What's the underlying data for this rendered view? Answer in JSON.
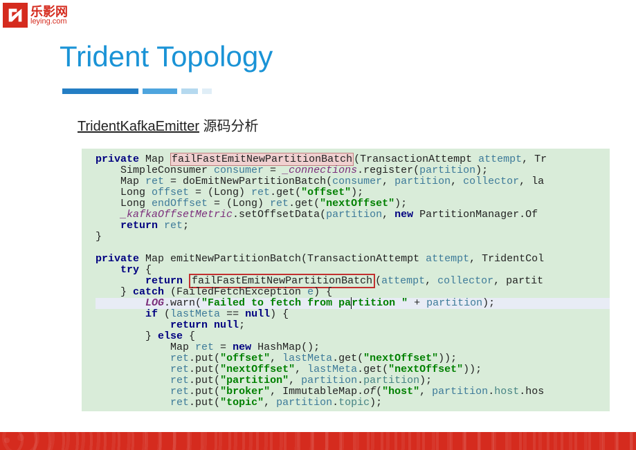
{
  "logo": {
    "cn": "乐影网",
    "en": "leying.com"
  },
  "title": "Trident Topology",
  "subtitle_link": "TridentKafkaEmitter",
  "subtitle_rest": " 源码分析",
  "code": {
    "l1_priv": "private",
    "l1_a": " Map ",
    "l1_method": "failFastEmitNewPartitionBatch",
    "l1_b": "(TransactionAttempt ",
    "l1_attempt": "attempt",
    "l1_c": ", Tr",
    "l2_a": "    SimpleConsumer ",
    "l2_consumer": "consumer",
    "l2_b": " = ",
    "l2_conn": "_connections",
    "l2_c": ".register(",
    "l2_part": "partition",
    "l2_d": ");",
    "l3_a": "    Map ",
    "l3_ret": "ret",
    "l3_b": " = doEmitNewPartitionBatch(",
    "l3_consumer": "consumer",
    "l3_c": ", ",
    "l3_part": "partition",
    "l3_d": ", ",
    "l3_coll": "collector",
    "l3_e": ", la",
    "l4_a": "    Long ",
    "l4_off": "offset",
    "l4_b": " = (Long) ",
    "l4_ret": "ret",
    "l4_c": ".get(",
    "l4_str": "\"offset\"",
    "l4_d": ");",
    "l5_a": "    Long ",
    "l5_end": "endOffset",
    "l5_b": " = (Long) ",
    "l5_ret": "ret",
    "l5_c": ".get(",
    "l5_str": "\"nextOffset\"",
    "l5_d": ");",
    "l6_a": "    ",
    "l6_kom": "_kafkaOffsetMetric",
    "l6_b": ".setOffsetData(",
    "l6_part": "partition",
    "l6_c": ", ",
    "l6_new": "new",
    "l6_d": " PartitionManager.Of",
    "l7_a": "    ",
    "l7_ret": "return",
    "l7_b": " ",
    "l7_retv": "ret",
    "l7_c": ";",
    "l8": "}",
    "l9": "",
    "l10_priv": "private",
    "l10_a": " Map emitNewPartitionBatch(TransactionAttempt ",
    "l10_attempt": "attempt",
    "l10_b": ", TridentCol",
    "l11_a": "    ",
    "l11_try": "try",
    "l11_b": " {",
    "l12_a": "        ",
    "l12_ret": "return",
    "l12_b": " ",
    "l12_box": "failFastEmitNewPartitionBatch",
    "l12_c": "(",
    "l12_attempt": "attempt",
    "l12_d": ", ",
    "l12_coll": "collector",
    "l12_e": ", partit",
    "l13_a": "    } ",
    "l13_catch": "catch",
    "l13_b": " (FailedFetchException ",
    "l13_e": "e",
    "l13_c": ") {",
    "l14_a": "        ",
    "l14_log": "LOG",
    "l14_b": ".warn(",
    "l14_str": "\"Failed to fetch from pa",
    "l14_str2": "rtition \"",
    "l14_c": " + ",
    "l14_part": "partition",
    "l14_d": ");",
    "l15_a": "        ",
    "l15_if": "if",
    "l15_b": " (",
    "l15_lm": "lastMeta",
    "l15_c": " == ",
    "l15_null": "null",
    "l15_d": ") {",
    "l16_a": "            ",
    "l16_ret": "return null",
    "l16_b": ";",
    "l17_a": "        } ",
    "l17_else": "else",
    "l17_b": " {",
    "l18_a": "            Map ",
    "l18_ret": "ret",
    "l18_b": " = ",
    "l18_new": "new",
    "l18_c": " HashMap();",
    "l19_a": "            ",
    "l19_ret": "ret",
    "l19_b": ".put(",
    "l19_s1": "\"offset\"",
    "l19_c": ", ",
    "l19_lm": "lastMeta",
    "l19_d": ".get(",
    "l19_s2": "\"nextOffset\"",
    "l19_e": "));",
    "l20_a": "            ",
    "l20_ret": "ret",
    "l20_b": ".put(",
    "l20_s1": "\"nextOffset\"",
    "l20_c": ", ",
    "l20_lm": "lastMeta",
    "l20_d": ".get(",
    "l20_s2": "\"nextOffset\"",
    "l20_e": "));",
    "l21_a": "            ",
    "l21_ret": "ret",
    "l21_b": ".put(",
    "l21_s1": "\"partition\"",
    "l21_c": ", ",
    "l21_part": "partition",
    "l21_d": ".",
    "l21_p2": "partition",
    "l21_e": ");",
    "l22_a": "            ",
    "l22_ret": "ret",
    "l22_b": ".put(",
    "l22_s1": "\"broker\"",
    "l22_c": ", ImmutableMap.",
    "l22_of": "of",
    "l22_d": "(",
    "l22_s2": "\"host\"",
    "l22_e": ", ",
    "l22_part": "partition",
    "l22_f": ".",
    "l22_host": "host",
    "l22_g": ".hos",
    "l23_a": "            ",
    "l23_ret": "ret",
    "l23_b": ".put(",
    "l23_s1": "\"topic\"",
    "l23_c": ", ",
    "l23_part": "partition",
    "l23_d": ".",
    "l23_topic": "topic",
    "l23_e": ");"
  }
}
